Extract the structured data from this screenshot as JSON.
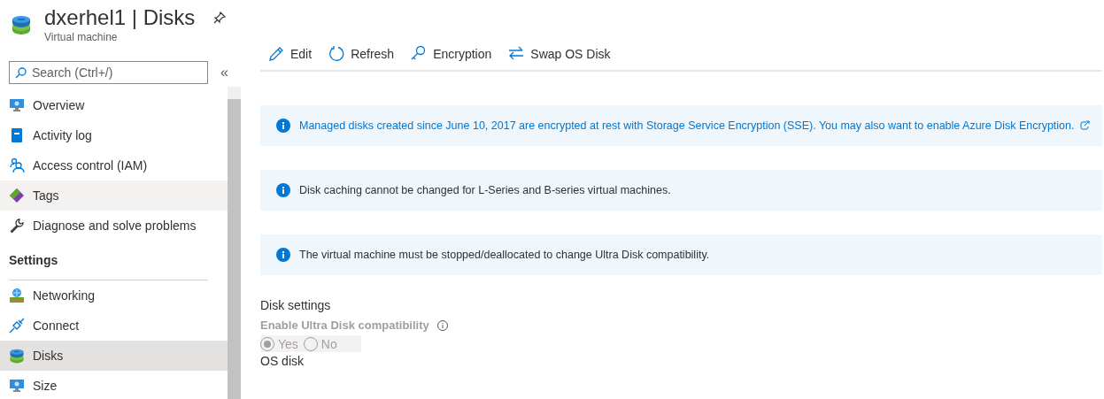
{
  "header": {
    "title": "dxerhel1 | Disks",
    "subtitle": "Virtual machine"
  },
  "sidebar": {
    "search": {
      "placeholder": "Search (Ctrl+/)"
    },
    "collapse": "«",
    "items": [
      {
        "kind": "item",
        "label": "Overview",
        "selected": false,
        "hovered": false
      },
      {
        "kind": "item",
        "label": "Activity log",
        "selected": false,
        "hovered": false
      },
      {
        "kind": "item",
        "label": "Access control (IAM)",
        "selected": false,
        "hovered": false
      },
      {
        "kind": "item",
        "label": "Tags",
        "selected": false,
        "hovered": true
      },
      {
        "kind": "item",
        "label": "Diagnose and solve problems",
        "selected": false,
        "hovered": false
      },
      {
        "kind": "section",
        "label": "Settings"
      },
      {
        "kind": "item",
        "label": "Networking",
        "selected": false,
        "hovered": false
      },
      {
        "kind": "item",
        "label": "Connect",
        "selected": false,
        "hovered": false
      },
      {
        "kind": "item",
        "label": "Disks",
        "selected": true,
        "hovered": false
      },
      {
        "kind": "item",
        "label": "Size",
        "selected": false,
        "hovered": false
      }
    ]
  },
  "toolbar": [
    {
      "label": "Edit"
    },
    {
      "label": "Refresh"
    },
    {
      "label": "Encryption"
    },
    {
      "label": "Swap OS Disk"
    }
  ],
  "banners": [
    {
      "kind": "link",
      "text": "Managed disks created since June 10, 2017 are encrypted at rest with Storage Service Encryption (SSE). You may also want to enable Azure Disk Encryption."
    },
    {
      "kind": "plain",
      "text": "Disk caching cannot be changed for L-Series and B-series virtual machines."
    },
    {
      "kind": "plain",
      "text": "The virtual machine must be stopped/deallocated to change Ultra Disk compatibility."
    }
  ],
  "disk_settings": {
    "heading": "Disk settings",
    "field_label": "Enable Ultra Disk compatibility",
    "disabled": true,
    "options": [
      {
        "label": "Yes",
        "selected": true
      },
      {
        "label": "No",
        "selected": false
      }
    ]
  },
  "os_disk": {
    "heading": "OS disk"
  }
}
